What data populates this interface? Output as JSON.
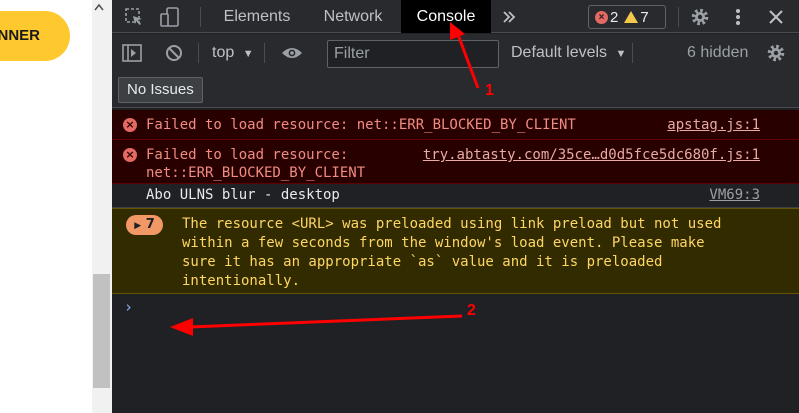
{
  "page": {
    "button_label": "ONNER"
  },
  "tabs": [
    {
      "label": "Elements",
      "active": false
    },
    {
      "label": "Network",
      "active": false
    },
    {
      "label": "Console",
      "active": true
    }
  ],
  "more_tabs_icon": "chevron-double-right-icon",
  "counts": {
    "errors": "2",
    "warnings": "7"
  },
  "toolbar": {
    "context": "top",
    "filter_placeholder": "Filter",
    "levels": "Default levels",
    "hidden": "6 hidden"
  },
  "issues_label": "No Issues",
  "messages": [
    {
      "type": "error",
      "text": "Failed to load resource: net::ERR_BLOCKED_BY_CLIENT",
      "source": "apstag.js:1"
    },
    {
      "type": "error",
      "text_line1": "Failed to load resource:",
      "text_line2": "net::ERR_BLOCKED_BY_CLIENT",
      "source": "try.abtasty.com/35ce…d0d5fce5dc680f.js:1"
    },
    {
      "type": "log",
      "text": "Abo ULNS blur - desktop",
      "source": "VM69:3"
    },
    {
      "type": "warning",
      "count": "7",
      "lines": [
        "The resource <URL> was preloaded using link preload but not used",
        "within a few seconds from the window's load event. Please make",
        "sure it has an appropriate `as` value and it is preloaded",
        "intentionally."
      ]
    }
  ],
  "prompt_symbol": "›",
  "annotations": {
    "arrow1": "1",
    "arrow2": "2"
  },
  "colors": {
    "accent_red": "#ff0000",
    "error_text": "#f28b82",
    "warning_text": "#fdd663"
  }
}
